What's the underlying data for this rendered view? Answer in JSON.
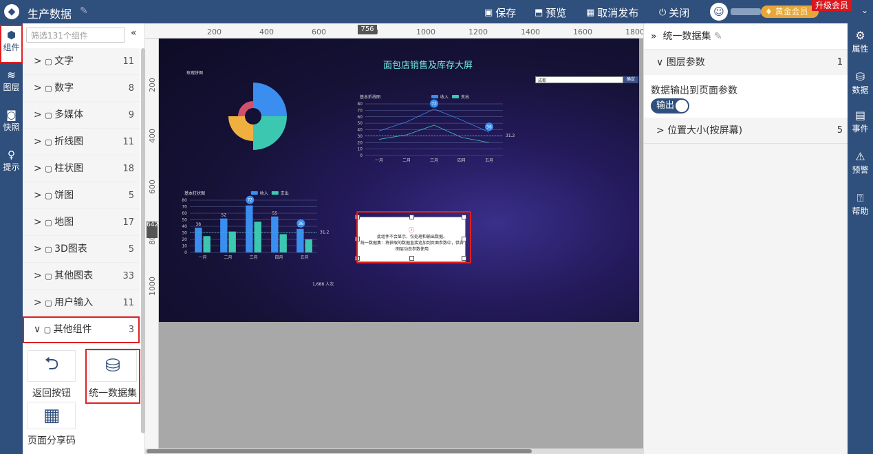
{
  "header": {
    "title": "生产数据",
    "actions": [
      {
        "icon": "save-icon",
        "label": "保存"
      },
      {
        "icon": "preview-icon",
        "label": "预览"
      },
      {
        "icon": "unpublish-icon",
        "label": "取消发布"
      },
      {
        "icon": "power-icon",
        "label": "关闭"
      }
    ],
    "vip_label": "黄金会员",
    "upgrade_label": "升级会员"
  },
  "left_rail": [
    {
      "label": "组件",
      "icon": "cube-icon"
    },
    {
      "label": "图层",
      "icon": "layers-icon"
    },
    {
      "label": "快照",
      "icon": "camera-icon"
    },
    {
      "label": "提示",
      "icon": "lightbulb-icon"
    }
  ],
  "component_panel": {
    "filter_placeholder": "筛选131个组件",
    "categories": [
      {
        "icon": "text-icon",
        "label": "文字",
        "count": "11"
      },
      {
        "icon": "number-icon",
        "label": "数字",
        "count": "8"
      },
      {
        "icon": "media-icon",
        "label": "多媒体",
        "count": "9"
      },
      {
        "icon": "line-chart-icon",
        "label": "折线图",
        "count": "11"
      },
      {
        "icon": "bar-chart-icon",
        "label": "柱状图",
        "count": "18"
      },
      {
        "icon": "pie-chart-icon",
        "label": "饼图",
        "count": "5"
      },
      {
        "icon": "map-icon",
        "label": "地图",
        "count": "17"
      },
      {
        "icon": "3d-chart-icon",
        "label": "3D图表",
        "count": "5"
      },
      {
        "icon": "other-chart-icon",
        "label": "其他图表",
        "count": "33"
      },
      {
        "icon": "input-icon",
        "label": "用户输入",
        "count": "11"
      },
      {
        "icon": "other-component-icon",
        "label": "其他组件",
        "count": "3"
      }
    ],
    "tiles": [
      {
        "icon": "back-arrow-icon",
        "label": "返回按钮"
      },
      {
        "icon": "database-icon",
        "label": "统一数据集"
      },
      {
        "icon": "qrcode-icon",
        "label": "页面分享码"
      }
    ]
  },
  "ruler": {
    "top_ticks": [
      "200",
      "400",
      "600",
      "800",
      "1000",
      "1200",
      "1400",
      "1600",
      "1800"
    ],
    "left_ticks": [
      "200",
      "400",
      "600",
      "800",
      "1000"
    ],
    "marker_top": "756",
    "marker_left": "642"
  },
  "canvas": {
    "title": "面包店销售及库存大屏",
    "ring_label": "玫瑰饼图",
    "search_value": "成都",
    "search_button": "确定",
    "visitors": "1,688 人次",
    "dataset_warning": "此组件不会显示，仅处理和输出数据。",
    "dataset_note": "统一数据集：将获取的数据直接追加到页面参数中，供各图层动态参数使用"
  },
  "chart_data": [
    {
      "type": "line",
      "title": "基本折线图",
      "categories": [
        "一月",
        "二月",
        "三月",
        "四月",
        "五月"
      ],
      "series": [
        {
          "name": "收入",
          "values": [
            38,
            52,
            72,
            55,
            36
          ],
          "color": "#3a8ef0"
        },
        {
          "name": "支出",
          "values": [
            25,
            32,
            47,
            28,
            20
          ],
          "color": "#3cc8b0"
        }
      ],
      "markers": [
        "72",
        "36"
      ],
      "avg_label": "31.2",
      "ylim": [
        0,
        80
      ],
      "yticks": [
        "0",
        "10",
        "20",
        "30",
        "40",
        "50",
        "60",
        "70",
        "80"
      ]
    },
    {
      "type": "bar",
      "title": "基本柱状图",
      "categories": [
        "一月",
        "二月",
        "三月",
        "四月",
        "五月"
      ],
      "series": [
        {
          "name": "收入",
          "values": [
            38,
            52,
            72,
            55,
            36
          ],
          "color": "#3a8ef0"
        },
        {
          "name": "支出",
          "values": [
            25,
            32,
            47,
            28,
            20
          ],
          "color": "#3cc8b0"
        }
      ],
      "value_labels": [
        "38",
        "52",
        "72",
        "55",
        "36"
      ],
      "avg_label": "31.2",
      "ylim": [
        0,
        80
      ],
      "yticks": [
        "0",
        "10",
        "20",
        "30",
        "40",
        "50",
        "60",
        "70",
        "80"
      ]
    }
  ],
  "right_panel": {
    "title": "统一数据集",
    "section_layer": "图层参数",
    "section_layer_count": "1",
    "output_label": "数据输出到页面参数",
    "toggle_label": "输出",
    "section_position": "位置大小(按屏幕)",
    "section_position_count": "5"
  },
  "right_rail": [
    {
      "label": "属性",
      "icon": "property-icon"
    },
    {
      "label": "数据",
      "icon": "data-icon"
    },
    {
      "label": "事件",
      "icon": "event-icon"
    },
    {
      "label": "预警",
      "icon": "alarm-icon"
    },
    {
      "label": "帮助",
      "icon": "help-icon"
    }
  ]
}
